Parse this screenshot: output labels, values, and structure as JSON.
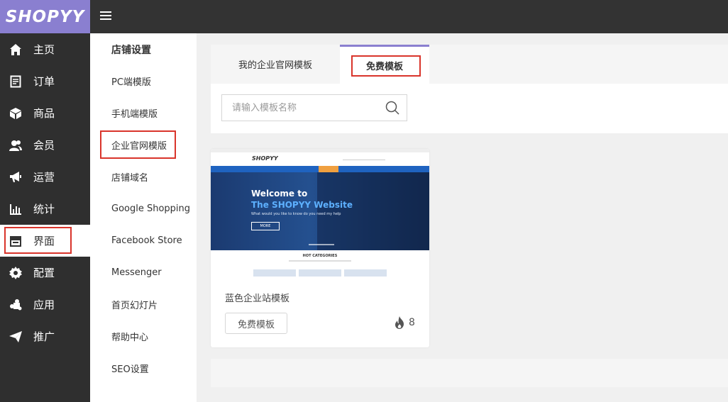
{
  "app": {
    "logo": "SHOPYY"
  },
  "sidebar": {
    "items": [
      {
        "label": "主页",
        "icon": "home-icon"
      },
      {
        "label": "订单",
        "icon": "document-icon"
      },
      {
        "label": "商品",
        "icon": "box-icon"
      },
      {
        "label": "会员",
        "icon": "users-icon"
      },
      {
        "label": "运营",
        "icon": "megaphone-icon"
      },
      {
        "label": "统计",
        "icon": "bar-chart-icon"
      },
      {
        "label": "界面",
        "icon": "storefront-icon",
        "active": true
      },
      {
        "label": "配置",
        "icon": "gear-icon"
      },
      {
        "label": "应用",
        "icon": "puzzle-icon"
      },
      {
        "label": "推广",
        "icon": "paper-plane-icon"
      }
    ]
  },
  "submenu": {
    "title": "店铺设置",
    "items": [
      "PC端模版",
      "手机端模版",
      "企业官网模版",
      "店铺域名",
      "Google Shopping",
      "Facebook Store",
      "Messenger",
      "首页幻灯片",
      "帮助中心",
      "SEO设置"
    ],
    "active_index": 2
  },
  "tabs": {
    "items": [
      "我的企业官网模板",
      "免费模板"
    ],
    "active_index": 1
  },
  "search": {
    "placeholder": "请输入模板名称",
    "value": ""
  },
  "templates": [
    {
      "name": "蓝色企业站模板",
      "button_label": "免费模板",
      "hot_count": "8",
      "preview": {
        "logo": "SHOPYY",
        "headline_1": "Welcome to",
        "headline_2": "The SHOPYY  Website",
        "tagline": "What would you like to know do you need my help",
        "more_button": "MORE",
        "section_title": "HOT CATEGORIES"
      }
    }
  ],
  "colors": {
    "brand": "#8a7fd0",
    "highlight": "#d9342b",
    "sidebar_bg": "#2f2f2f",
    "topbar_bg": "#333333",
    "preview_blue": "#1f63c0"
  }
}
